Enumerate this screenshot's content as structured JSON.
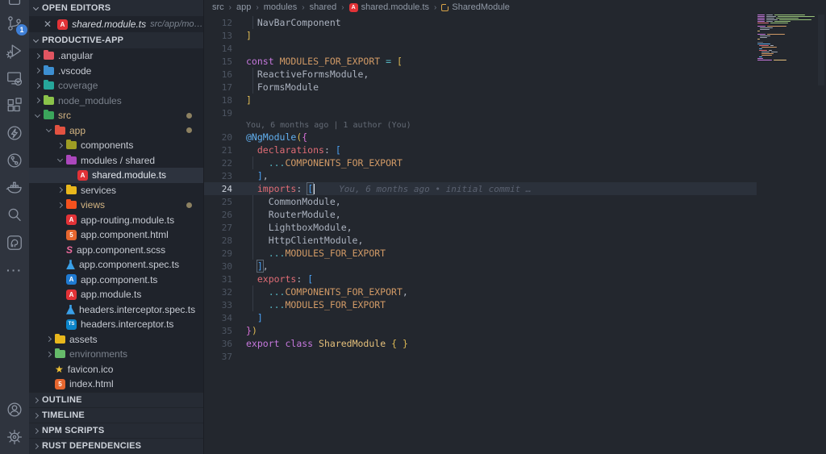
{
  "activity_bar": {
    "badge_count": "1",
    "icons": [
      "files-icon",
      "source-control-icon",
      "run-debug-icon",
      "remote-explorer-icon",
      "extensions-icon",
      "thunder-client-icon",
      "commit-graph-icon",
      "docker-icon",
      "search-icon",
      "postgres-icon",
      "more-actions-icon",
      "account-icon",
      "settings-gear-icon"
    ]
  },
  "sidebar": {
    "open_editors": {
      "header": "OPEN EDITORS",
      "file": {
        "name": "shared.module.ts",
        "path": "src/app/mo…",
        "icon": "angular-icon"
      }
    },
    "explorer": {
      "header": "PRODUCTIVE-APP",
      "tree": [
        {
          "level": 0,
          "chev": "right",
          "icon": "folder",
          "color": "#e05561",
          "label": ".angular",
          "style": "normal",
          "dot": false
        },
        {
          "level": 0,
          "chev": "right",
          "icon": "folder",
          "color": "#3d8fd1",
          "label": ".vscode",
          "style": "normal",
          "dot": false
        },
        {
          "level": 0,
          "chev": "right",
          "icon": "folder",
          "color": "#26a69a",
          "label": "coverage",
          "style": "ign",
          "dot": false
        },
        {
          "level": 0,
          "chev": "right",
          "icon": "folder",
          "color": "#8bc34a",
          "label": "node_modules",
          "style": "ign",
          "dot": false
        },
        {
          "level": 0,
          "chev": "down",
          "icon": "folder",
          "color": "#3ba55b",
          "label": "src",
          "style": "mod",
          "dot": true
        },
        {
          "level": 1,
          "chev": "down",
          "icon": "folder",
          "color": "#e25241",
          "label": "app",
          "style": "mod",
          "dot": true
        },
        {
          "level": 2,
          "chev": "right",
          "icon": "folder",
          "color": "#9e9d24",
          "label": "components",
          "style": "normal",
          "dot": false
        },
        {
          "level": 2,
          "chev": "down",
          "icon": "folder",
          "color": "#ab47bc",
          "label": "modules / shared",
          "style": "normal",
          "dot": false
        },
        {
          "level": 3,
          "chev": null,
          "icon": "ng-red",
          "label": "shared.module.ts",
          "style": "sel",
          "dot": false,
          "selected": true
        },
        {
          "level": 2,
          "chev": "right",
          "icon": "folder",
          "color": "#e8b71c",
          "label": "services",
          "style": "normal",
          "dot": false
        },
        {
          "level": 2,
          "chev": "right",
          "icon": "folder",
          "color": "#f4511e",
          "label": "views",
          "style": "mod",
          "dot": true
        },
        {
          "level": 2,
          "chev": null,
          "icon": "ng-red",
          "label": "app-routing.module.ts",
          "style": "normal",
          "dot": false
        },
        {
          "level": 2,
          "chev": null,
          "icon": "html",
          "label": "app.component.html",
          "style": "normal",
          "dot": false
        },
        {
          "level": 2,
          "chev": null,
          "icon": "scss",
          "label": "app.component.scss",
          "style": "normal",
          "dot": false
        },
        {
          "level": 2,
          "chev": null,
          "icon": "flask",
          "label": "app.component.spec.ts",
          "style": "normal",
          "dot": false
        },
        {
          "level": 2,
          "chev": null,
          "icon": "ng-blue",
          "label": "app.component.ts",
          "style": "normal",
          "dot": false
        },
        {
          "level": 2,
          "chev": null,
          "icon": "ng-red",
          "label": "app.module.ts",
          "style": "normal",
          "dot": false
        },
        {
          "level": 2,
          "chev": null,
          "icon": "flask",
          "label": "headers.interceptor.spec.ts",
          "style": "normal",
          "dot": false
        },
        {
          "level": 2,
          "chev": null,
          "icon": "ts",
          "label": "headers.interceptor.ts",
          "style": "normal",
          "dot": false
        },
        {
          "level": 1,
          "chev": "right",
          "icon": "folder",
          "color": "#e8b71c",
          "label": "assets",
          "style": "normal",
          "dot": false
        },
        {
          "level": 1,
          "chev": "right",
          "icon": "folder",
          "color": "#66bb6a",
          "label": "environments",
          "style": "ign",
          "dot": false
        },
        {
          "level": 1,
          "chev": null,
          "icon": "star",
          "label": "favicon.ico",
          "style": "normal",
          "dot": false
        },
        {
          "level": 1,
          "chev": null,
          "icon": "html",
          "label": "index.html",
          "style": "normal",
          "dot": false
        }
      ]
    },
    "sections": [
      "OUTLINE",
      "TIMELINE",
      "NPM SCRIPTS",
      "RUST DEPENDENCIES"
    ]
  },
  "editor": {
    "breadcrumbs": {
      "path": [
        "src",
        "app",
        "modules",
        "shared"
      ],
      "file": "shared.module.ts",
      "symbol": "SharedModule"
    },
    "codelens": "You, 6 months ago | 1 author (You)",
    "blame": "You, 6 months ago • initial commit …",
    "current_line": 24,
    "lines": [
      {
        "num": 12,
        "g": 1,
        "tokens": [
          [
            "  NavBarComponent",
            "fg"
          ]
        ]
      },
      {
        "num": 13,
        "tokens": [
          [
            "]",
            "b1"
          ]
        ]
      },
      {
        "num": 14,
        "tokens": []
      },
      {
        "num": 15,
        "tokens": [
          [
            "const",
            "kw"
          ],
          [
            " ",
            "fg"
          ],
          [
            "MODULES_FOR_EXPORT",
            "const"
          ],
          [
            " ",
            "fg"
          ],
          [
            "=",
            "op"
          ],
          [
            " ",
            "fg"
          ],
          [
            "[",
            "b1"
          ]
        ]
      },
      {
        "num": 16,
        "g": 1,
        "tokens": [
          [
            "  ReactiveFormsModule,",
            "fg"
          ]
        ]
      },
      {
        "num": 17,
        "g": 1,
        "tokens": [
          [
            "  FormsModule",
            "fg"
          ]
        ]
      },
      {
        "num": 18,
        "tokens": [
          [
            "]",
            "b1"
          ]
        ]
      },
      {
        "num": 19,
        "tokens": []
      },
      {
        "num": 20,
        "lens": true,
        "tokens": [
          [
            "@NgModule",
            "deco"
          ],
          [
            "(",
            "b1"
          ],
          [
            "{",
            "b2"
          ]
        ]
      },
      {
        "num": 21,
        "tokens": [
          [
            "  ",
            "fg"
          ],
          [
            "declarations",
            "prop"
          ],
          [
            ":",
            "fg"
          ],
          [
            " ",
            "fg"
          ],
          [
            "[",
            "b3"
          ]
        ]
      },
      {
        "num": 22,
        "g": 1,
        "tokens": [
          [
            "    ",
            "fg"
          ],
          [
            "...",
            "op"
          ],
          [
            "COMPONENTS_FOR_EXPORT",
            "const"
          ]
        ]
      },
      {
        "num": 23,
        "tokens": [
          [
            "  ",
            "fg"
          ],
          [
            "]",
            "b3"
          ],
          [
            ",",
            "fg"
          ]
        ]
      },
      {
        "num": 24,
        "current": true,
        "blame": true,
        "tokens": [
          [
            "  ",
            "fg"
          ],
          [
            "imports",
            "prop"
          ],
          [
            ":",
            "fg"
          ],
          [
            " ",
            "fg"
          ],
          [
            "[",
            "b3 match"
          ],
          [
            "CURSOR",
            "cursor"
          ]
        ]
      },
      {
        "num": 25,
        "g": 1,
        "tokens": [
          [
            "    CommonModule,",
            "fg"
          ]
        ]
      },
      {
        "num": 26,
        "g": 1,
        "tokens": [
          [
            "    RouterModule,",
            "fg"
          ]
        ]
      },
      {
        "num": 27,
        "g": 1,
        "tokens": [
          [
            "    LightboxModule,",
            "fg"
          ]
        ]
      },
      {
        "num": 28,
        "g": 1,
        "tokens": [
          [
            "    HttpClientModule,",
            "fg"
          ]
        ]
      },
      {
        "num": 29,
        "g": 1,
        "tokens": [
          [
            "    ",
            "fg"
          ],
          [
            "...",
            "op"
          ],
          [
            "MODULES_FOR_EXPORT",
            "const"
          ]
        ]
      },
      {
        "num": 30,
        "tokens": [
          [
            "  ",
            "fg"
          ],
          [
            "]",
            "b3 match"
          ],
          [
            ",",
            "fg"
          ]
        ]
      },
      {
        "num": 31,
        "tokens": [
          [
            "  ",
            "fg"
          ],
          [
            "exports",
            "prop"
          ],
          [
            ":",
            "fg"
          ],
          [
            " ",
            "fg"
          ],
          [
            "[",
            "b3"
          ]
        ]
      },
      {
        "num": 32,
        "g": 1,
        "tokens": [
          [
            "    ",
            "fg"
          ],
          [
            "...",
            "op"
          ],
          [
            "COMPONENTS_FOR_EXPORT",
            "const"
          ],
          [
            ",",
            "fg"
          ]
        ]
      },
      {
        "num": 33,
        "g": 1,
        "tokens": [
          [
            "    ",
            "fg"
          ],
          [
            "...",
            "op"
          ],
          [
            "MODULES_FOR_EXPORT",
            "const"
          ]
        ]
      },
      {
        "num": 34,
        "tokens": [
          [
            "  ",
            "fg"
          ],
          [
            "]",
            "b3"
          ]
        ]
      },
      {
        "num": 35,
        "tokens": [
          [
            "}",
            "b2"
          ],
          [
            ")",
            "b1"
          ]
        ]
      },
      {
        "num": 36,
        "tokens": [
          [
            "export",
            "kw"
          ],
          [
            " ",
            "fg"
          ],
          [
            "class",
            "kw"
          ],
          [
            " ",
            "fg"
          ],
          [
            "SharedModule",
            "cls"
          ],
          [
            " ",
            "fg"
          ],
          [
            "{",
            "b1"
          ],
          [
            " ",
            "fg"
          ],
          [
            "}",
            "b1"
          ]
        ]
      },
      {
        "num": 37,
        "tokens": []
      }
    ]
  },
  "minimap": {
    "rows": [
      [
        0,
        [
          9,
          "#c678dd"
        ],
        [
          8,
          "#9aa2ae"
        ],
        [
          38,
          "#98c379"
        ]
      ],
      [
        0,
        [
          9,
          "#c678dd"
        ],
        [
          12,
          "#9aa2ae"
        ],
        [
          46,
          "#98c379"
        ]
      ],
      [
        0,
        [
          9,
          "#c678dd"
        ],
        [
          10,
          "#9aa2ae"
        ],
        [
          28,
          "#98c379"
        ]
      ],
      [
        0,
        [
          9,
          "#c678dd"
        ],
        [
          14,
          "#9aa2ae"
        ],
        [
          40,
          "#98c379"
        ]
      ],
      [
        0,
        [
          9,
          "#c678dd"
        ],
        [
          8,
          "#9aa2ae"
        ],
        [
          20,
          "#98c379"
        ]
      ],
      [
        0,
        [
          14,
          "#e06c75"
        ],
        [
          22,
          "#98c379"
        ]
      ],
      [
        0
      ],
      [
        0,
        [
          10,
          "#c678dd"
        ],
        [
          24,
          "#d19a66"
        ]
      ],
      [
        3,
        [
          16,
          "#9aa2ae"
        ]
      ],
      [
        3,
        [
          12,
          "#9aa2ae"
        ]
      ],
      [
        0,
        [
          3,
          "#e5c07b"
        ]
      ],
      [
        0
      ],
      [
        0,
        [
          10,
          "#c678dd"
        ],
        [
          22,
          "#d19a66"
        ]
      ],
      [
        3,
        [
          13,
          "#9aa2ae"
        ]
      ],
      [
        3,
        [
          9,
          "#9aa2ae"
        ]
      ],
      [
        0,
        [
          3,
          "#e5c07b"
        ]
      ],
      [
        0
      ],
      [
        0,
        [
          7,
          "#5c6370"
        ]
      ],
      [
        0,
        [
          16,
          "#61afef"
        ]
      ],
      [
        2,
        [
          12,
          "#e06c75"
        ],
        [
          4,
          "#abb2bf"
        ]
      ],
      [
        5,
        [
          19,
          "#d19a66"
        ]
      ],
      [
        2,
        [
          4,
          "#61afef"
        ]
      ],
      [
        2,
        [
          10,
          "#e06c75"
        ],
        [
          4,
          "#abb2bf"
        ]
      ],
      [
        5,
        [
          10,
          "#9aa2ae"
        ],
        [
          8,
          "#9aa2ae"
        ]
      ],
      [
        5,
        [
          15,
          "#d19a66"
        ]
      ],
      [
        5,
        [
          13,
          "#d19a66"
        ]
      ],
      [
        2,
        [
          4,
          "#61afef"
        ]
      ],
      [
        0,
        [
          7,
          "#c678dd"
        ]
      ],
      [
        0,
        [
          18,
          "#c678dd"
        ],
        [
          16,
          "#e5c07b"
        ]
      ]
    ]
  }
}
